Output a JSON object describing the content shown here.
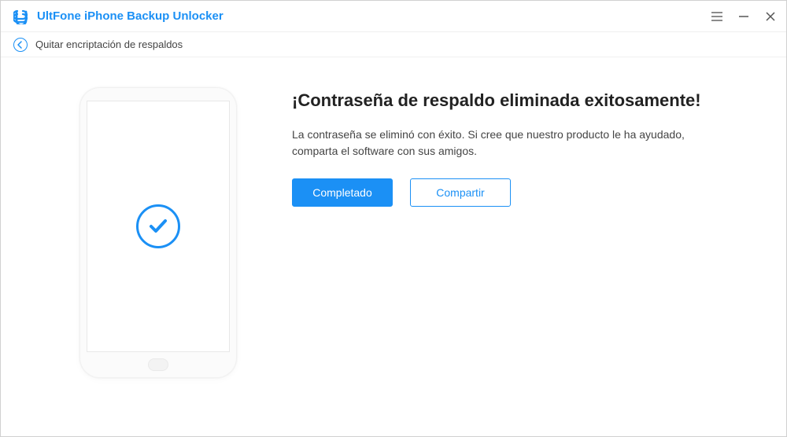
{
  "app": {
    "title": "UltFone iPhone Backup Unlocker"
  },
  "subheader": {
    "title": "Quitar encriptación de respaldos"
  },
  "main": {
    "headline": "¡Contraseña de respaldo eliminada exitosamente!",
    "description": "La contraseña se eliminó con éxito. Si cree que nuestro producto le ha ayudado, comparta el software con sus amigos.",
    "buttons": {
      "complete": "Completado",
      "share": "Compartir"
    }
  },
  "colors": {
    "accent": "#1b90f5"
  }
}
